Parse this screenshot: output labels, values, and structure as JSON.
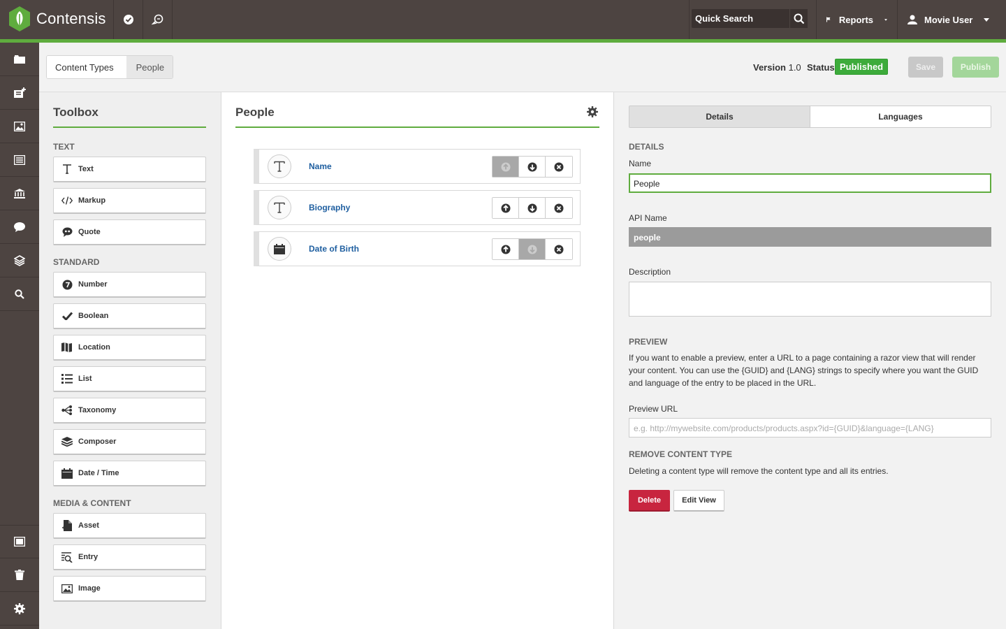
{
  "app": {
    "name": "Contensis"
  },
  "topbar": {
    "quick_search_label": "Quick Search",
    "reports_label": "Reports",
    "user_label": "Movie User"
  },
  "breadcrumb": {
    "items": [
      "Content Types",
      "People"
    ]
  },
  "header": {
    "version_label": "Version",
    "version_value": "1.0",
    "status_label": "Status",
    "status_value": "Published",
    "save_label": "Save",
    "publish_label": "Publish"
  },
  "toolbox": {
    "title": "Toolbox",
    "sections": [
      {
        "heading": "TEXT",
        "items": [
          "Text",
          "Markup",
          "Quote"
        ]
      },
      {
        "heading": "STANDARD",
        "items": [
          "Number",
          "Boolean",
          "Location",
          "List",
          "Taxonomy",
          "Composer",
          "Date / Time"
        ]
      },
      {
        "heading": "MEDIA & CONTENT",
        "items": [
          "Asset",
          "Entry",
          "Image"
        ]
      }
    ]
  },
  "content_type": {
    "title": "People",
    "fields": [
      {
        "name": "Name",
        "icon": "text-icon"
      },
      {
        "name": "Biography",
        "icon": "text-icon"
      },
      {
        "name": "Date of Birth",
        "icon": "calendar-icon"
      }
    ]
  },
  "details": {
    "tabs": [
      "Details",
      "Languages"
    ],
    "details_heading": "DETAILS",
    "name_label": "Name",
    "name_value": "People",
    "api_name_label": "API Name",
    "api_name_value": "people",
    "description_label": "Description",
    "preview_heading": "PREVIEW",
    "preview_text": "If you want to enable a preview, enter a URL to a page containing a razor view that will render your content. You can use the {GUID} and {LANG} strings to specify where you want the GUID and language of the entry to be placed in the URL.",
    "preview_url_label": "Preview URL",
    "preview_url_placeholder": "e.g. http://mywebsite.com/products/products.aspx?id={GUID}&language={LANG}",
    "remove_heading": "REMOVE CONTENT TYPE",
    "remove_text": "Deleting a content type will remove the content type and all its entries.",
    "delete_label": "Delete",
    "edit_view_label": "Edit View"
  },
  "colors": {
    "brand_green": "#5fac3e",
    "topbar": "#4d4441",
    "danger": "#c8253f",
    "link": "#1f5fa0"
  }
}
